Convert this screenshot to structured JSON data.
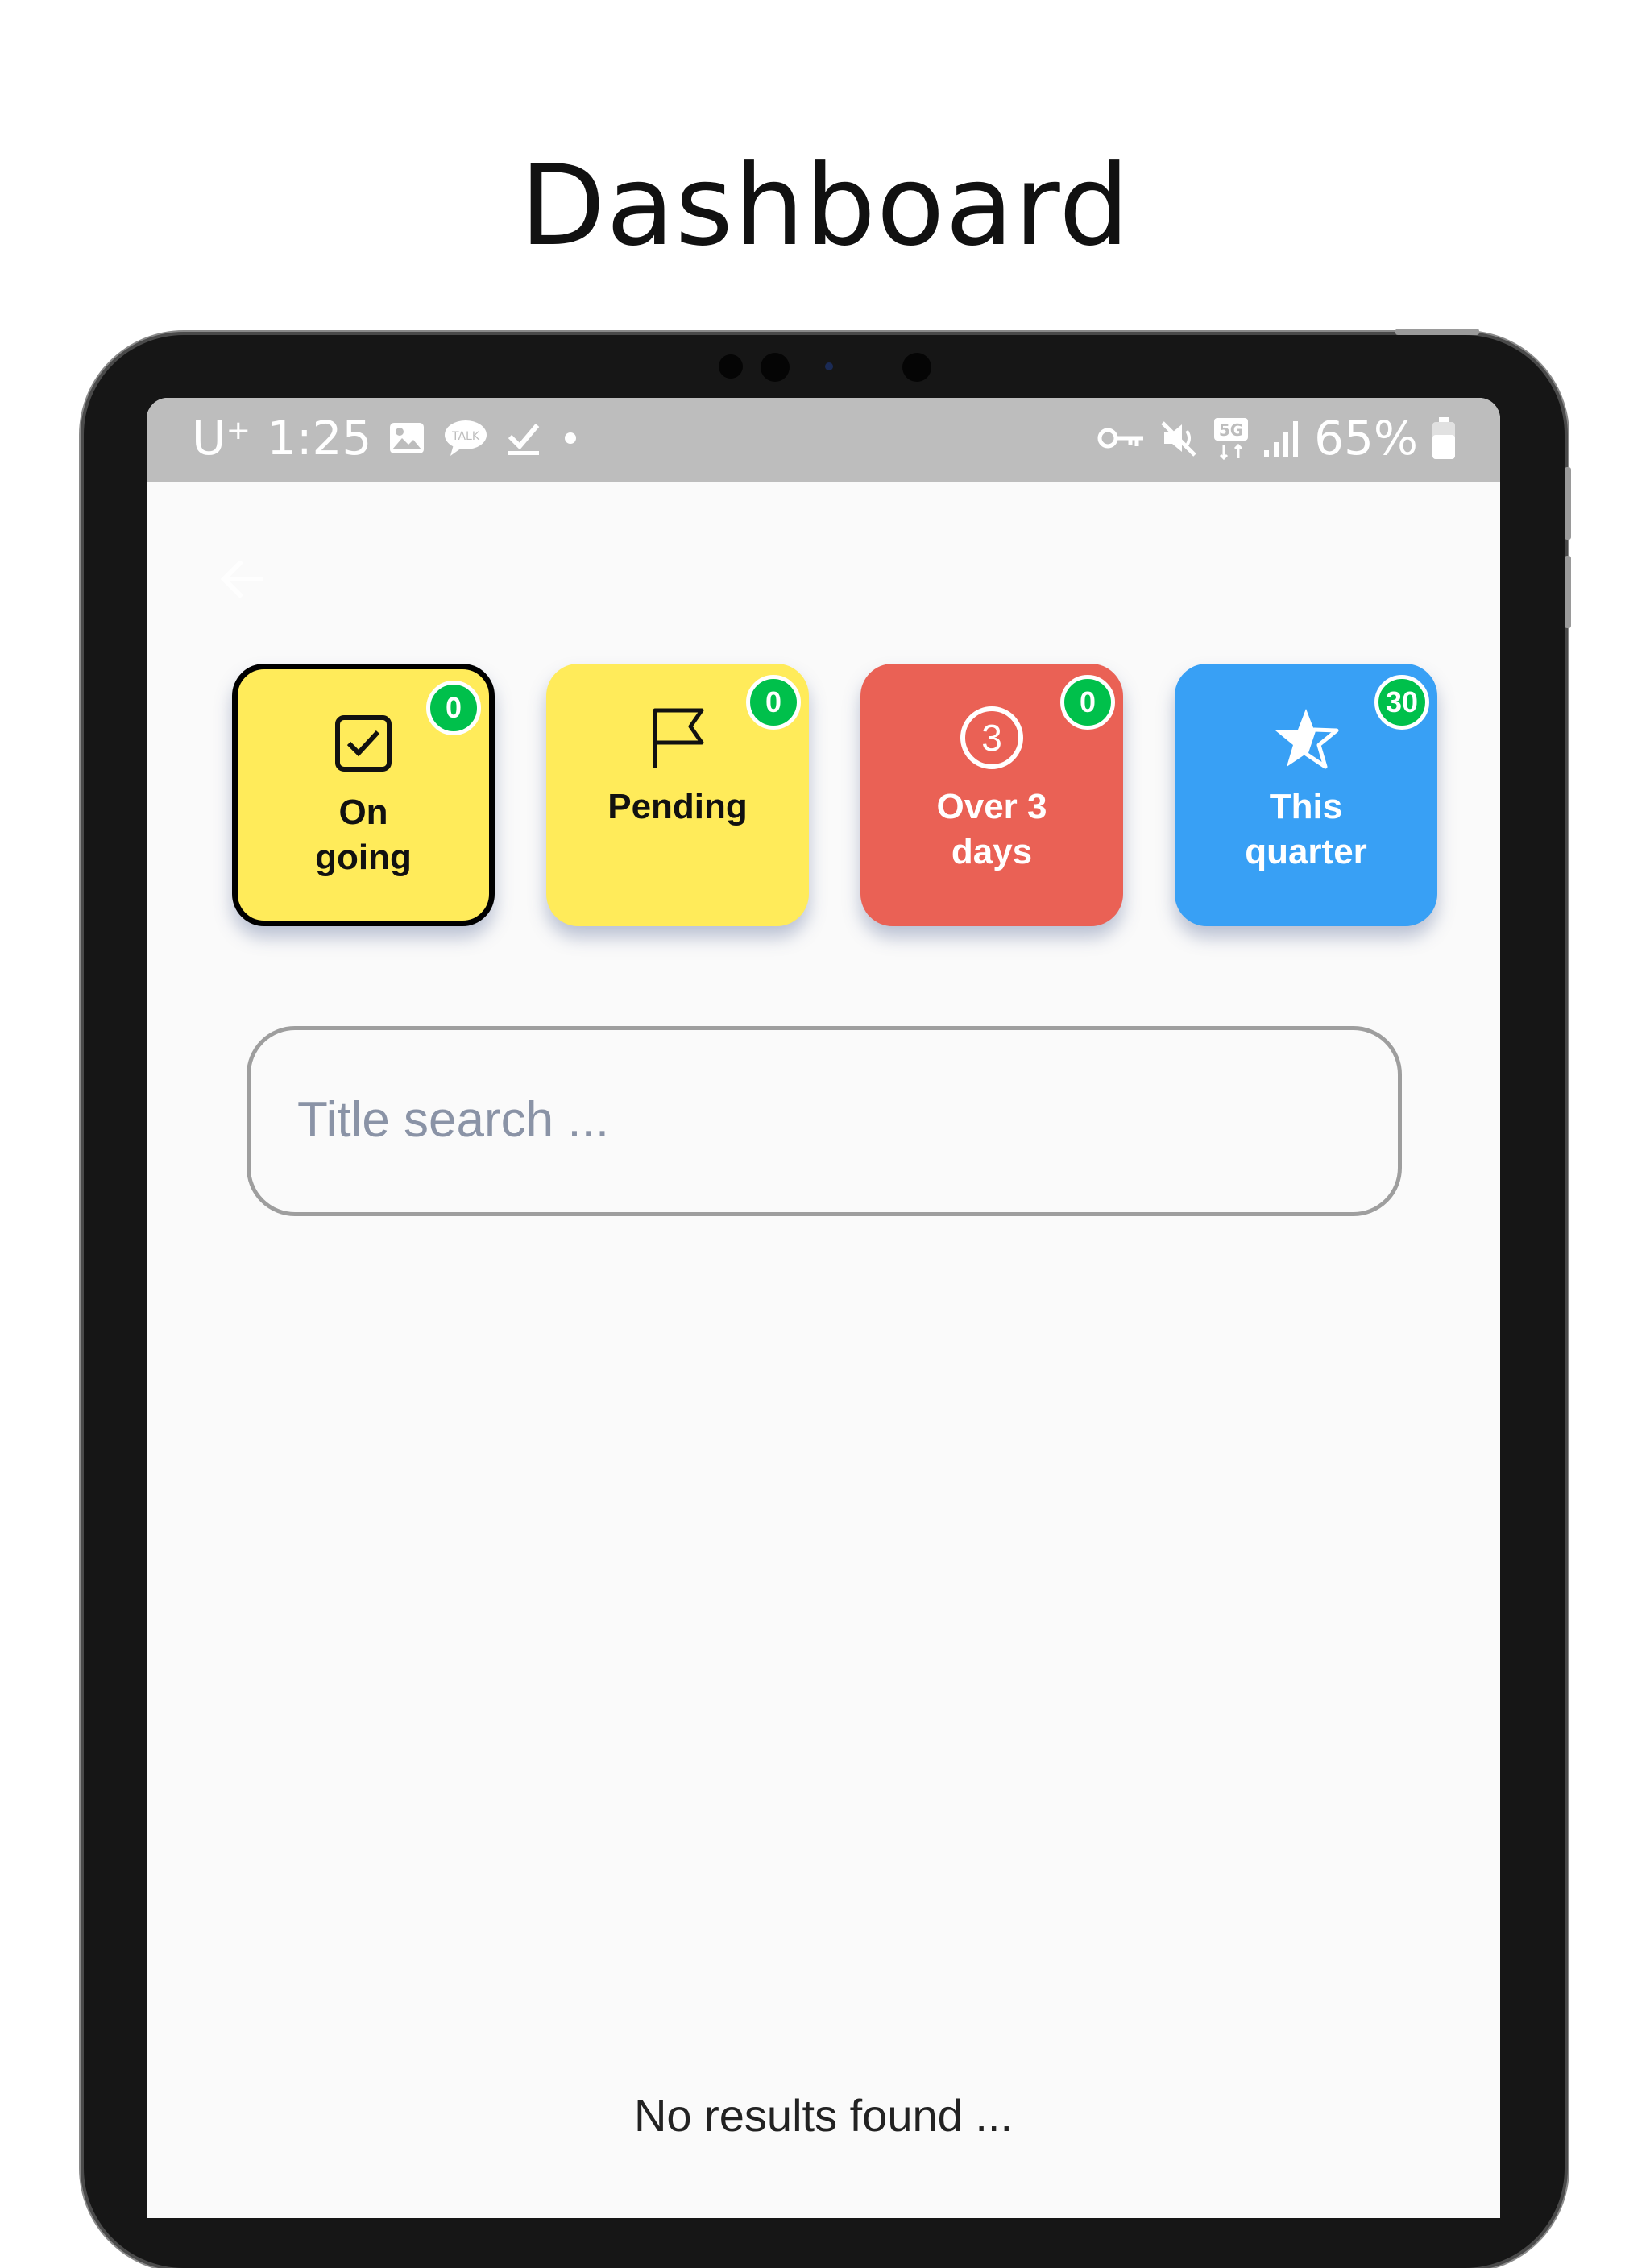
{
  "page": {
    "title": "Dashboard"
  },
  "status_bar": {
    "carrier": "U⁺",
    "time": "1:25",
    "battery": "65%",
    "left_icons": [
      "gallery-icon",
      "kakaotalk-icon",
      "download-done-icon",
      "dot-icon"
    ],
    "right_icons": [
      "vpn-key-icon",
      "mute-icon",
      "5g-icon",
      "signal-icon",
      "battery-icon"
    ]
  },
  "toolbar": {
    "back_icon": "arrow-left-icon"
  },
  "tiles": [
    {
      "label": "On\ngoing",
      "count": "0",
      "icon": "checkbox-icon",
      "color": "#ffeb5a",
      "text_color": "#111111",
      "selected": true
    },
    {
      "label": "Pending",
      "count": "0",
      "icon": "flag-icon",
      "color": "#ffeb5a",
      "text_color": "#111111",
      "selected": false
    },
    {
      "label": "Over 3\ndays",
      "count": "0",
      "icon": "circled-three-icon",
      "color": "#ea6155",
      "text_color": "#ffffff",
      "selected": false
    },
    {
      "label": "This\nquarter",
      "count": "30",
      "icon": "star-icon",
      "color": "#38a0f5",
      "text_color": "#ffffff",
      "selected": false
    }
  ],
  "search": {
    "placeholder": "Title search ...",
    "value": ""
  },
  "results": {
    "empty_message": "No results found ..."
  },
  "colors": {
    "badge": "#00c04b",
    "statusbar": "#bdbdbd",
    "background": "#fafafa"
  }
}
